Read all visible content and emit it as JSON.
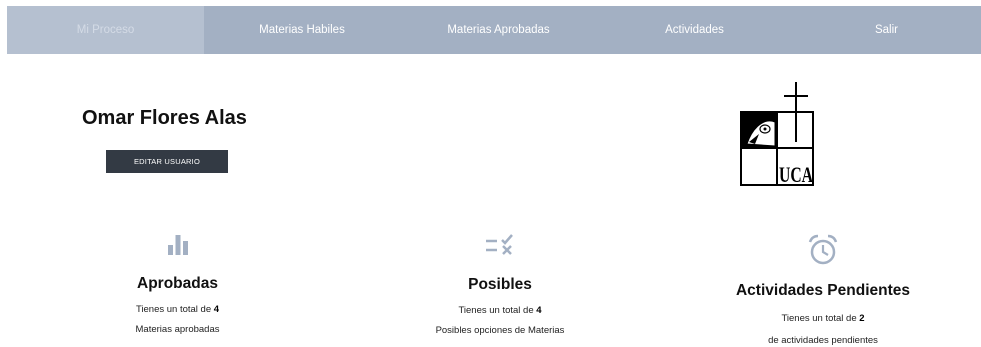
{
  "nav": {
    "items": [
      {
        "label": "Mi Proceso",
        "active": true
      },
      {
        "label": "Materias Habiles",
        "active": false
      },
      {
        "label": "Materias Aprobadas",
        "active": false
      },
      {
        "label": "Actividades",
        "active": false
      },
      {
        "label": "Salir",
        "active": false
      }
    ]
  },
  "profile": {
    "name": "Omar Flores Alas",
    "edit_button": "EDITAR USUARIO"
  },
  "logo": {
    "text": "UCA"
  },
  "cards": {
    "aprobadas": {
      "icon": "bar-chart-icon",
      "title": "Aprobadas",
      "line1_prefix": "Tienes un total de ",
      "count": "4",
      "line2": "Materias aprobadas"
    },
    "posibles": {
      "icon": "checklist-icon",
      "title": "Posibles",
      "line1_prefix": "Tienes un total de ",
      "count": "4",
      "line2": "Posibles opciones de Materias"
    },
    "pendientes": {
      "icon": "alarm-clock-icon",
      "title": "Actividades Pendientes",
      "line1_prefix": "Tienes un total de ",
      "count": "2",
      "line2": "de actividades pendientes"
    }
  },
  "colors": {
    "nav_bg": "#a3b0c3",
    "nav_active_bg": "#b5c0d0",
    "icon": "#a3b0c3",
    "button_bg": "#333a44"
  }
}
